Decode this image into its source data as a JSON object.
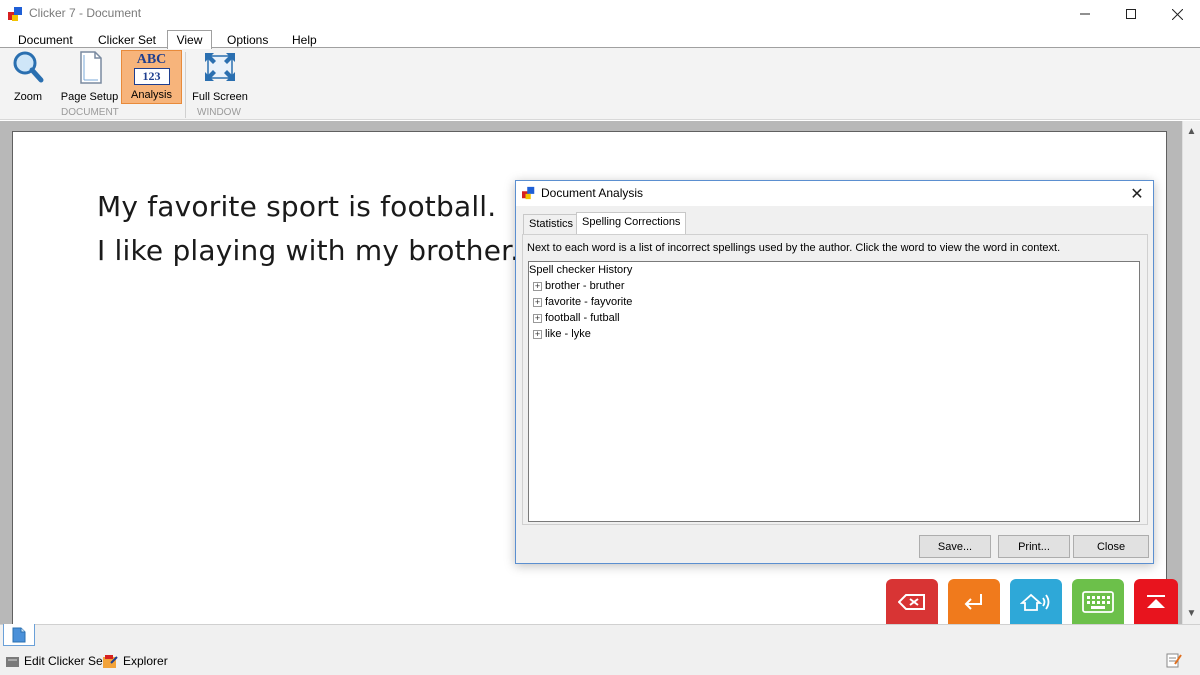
{
  "window": {
    "title": "Clicker 7 - Document"
  },
  "menu": [
    "Document",
    "Clicker Set",
    "View",
    "Options",
    "Help"
  ],
  "ribbon": {
    "buttons": {
      "zoom": "Zoom",
      "page_setup": "Page Setup",
      "analysis": "Analysis",
      "analysis_icon_text_top": "ABC",
      "analysis_icon_text_bottom": "123",
      "full_screen": "Full Screen"
    },
    "groups": {
      "document": "DOCUMENT",
      "window": "WINDOW"
    }
  },
  "document": {
    "lines": [
      "My favorite sport is football.",
      "I like playing with my brother."
    ]
  },
  "dialog": {
    "title": "Document Analysis",
    "tabs": [
      "Statistics",
      "Spelling Corrections"
    ],
    "active_tab": "Spelling Corrections",
    "description": "Next to each word is a list of incorrect spellings used by the author. Click the word to view the word in context.",
    "tree_root": "Spell checker History",
    "tree_items": [
      "brother - bruther",
      "favorite - fayvorite",
      "football - futball",
      "like - lyke"
    ],
    "buttons": {
      "save": "Save...",
      "print": "Print...",
      "close": "Close"
    }
  },
  "statusbar": {
    "edit_clicker_set": "Edit Clicker Set",
    "explorer": "Explorer"
  },
  "colors": {
    "analysis_active": "#f7b47b",
    "key_delete": "#d83434",
    "key_enter": "#f07a1c",
    "key_speak": "#2ea8d8",
    "key_keyboard": "#6cc04a",
    "key_collapse": "#e8141e"
  }
}
